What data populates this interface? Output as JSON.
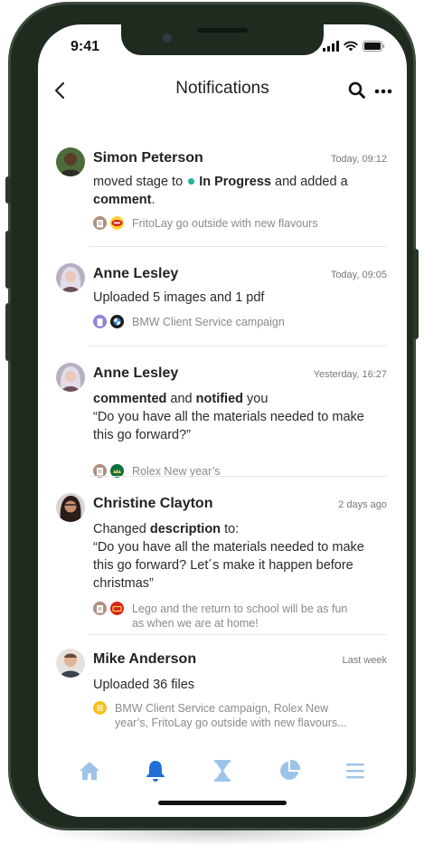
{
  "status_bar": {
    "time": "9:41"
  },
  "header": {
    "title": "Notifications"
  },
  "notifications": [
    {
      "name": "Simon Peterson",
      "time": "Today, 09:12",
      "text_1": "moved stage to",
      "stage": "In Progress",
      "text_2": "and added a",
      "text_3": "comment",
      "text_4": ".",
      "project": "FritoLay go outside with new flavours"
    },
    {
      "name": "Anne Lesley",
      "time": "Today, 09:05",
      "text_1": "Uploaded 5 images and 1 pdf",
      "project": "BMW Client Service campaign"
    },
    {
      "name": "Anne Lesley",
      "time": "Yesterday, 16:27",
      "text_1": "commented",
      "text_2": "and",
      "text_3": "notified",
      "text_4": "you",
      "quote": "“Do you have all the materials needed to make this go forward?”",
      "project": "Rolex New year’s"
    },
    {
      "name": "Christine Clayton",
      "time": "2 days ago",
      "text_1": "Changed",
      "text_2": "description",
      "text_3": "to:",
      "quote": "“Do you have all the materials needed to make this go forward? Let´s make it happen before christmas”",
      "project": "Lego and the return to school will be as fun as when we are at home!"
    },
    {
      "name": "Mike Anderson",
      "time": "Last week",
      "text_1": "Uploaded 36 files",
      "project": "BMW Client Service campaign, Rolex New year’s, FritoLay go outside with new flavours..."
    }
  ],
  "colors": {
    "accent": "#1f6fd6",
    "tab_inactive": "#9cc4ea",
    "stage_dot": "#1bb59a",
    "phone_frame": "#1f2b1f"
  },
  "tabbar": {
    "items": [
      {
        "icon": "home-icon",
        "active": false
      },
      {
        "icon": "bell-icon",
        "active": true
      },
      {
        "icon": "hourglass-icon",
        "active": false
      },
      {
        "icon": "pie-chart-icon",
        "active": false
      },
      {
        "icon": "menu-icon",
        "active": false
      }
    ]
  }
}
